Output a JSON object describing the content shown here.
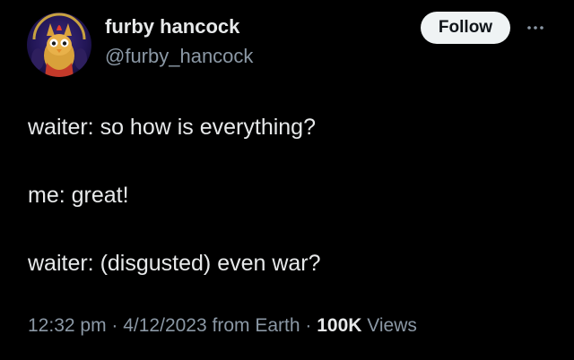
{
  "author": {
    "name": "furby hancock",
    "handle": "@furby_hancock",
    "avatar_icon": "furby-avatar-icon"
  },
  "actions": {
    "follow_label": "Follow",
    "more_icon": "more-options-icon"
  },
  "tweet": {
    "lines": [
      "waiter: so how is everything?",
      "me: great!",
      "waiter: (disgusted) even war?"
    ]
  },
  "meta": {
    "time": "12:32 pm",
    "sep1": " · ",
    "date": "4/12/2023",
    "source": " from Earth",
    "sep2": " · ",
    "views_count": "100K",
    "views_label": " Views"
  },
  "colors": {
    "background": "#000000",
    "text": "#e7e9ea",
    "secondary": "#8b98a5",
    "follow_bg": "#eff3f4",
    "follow_text": "#0f1419"
  }
}
